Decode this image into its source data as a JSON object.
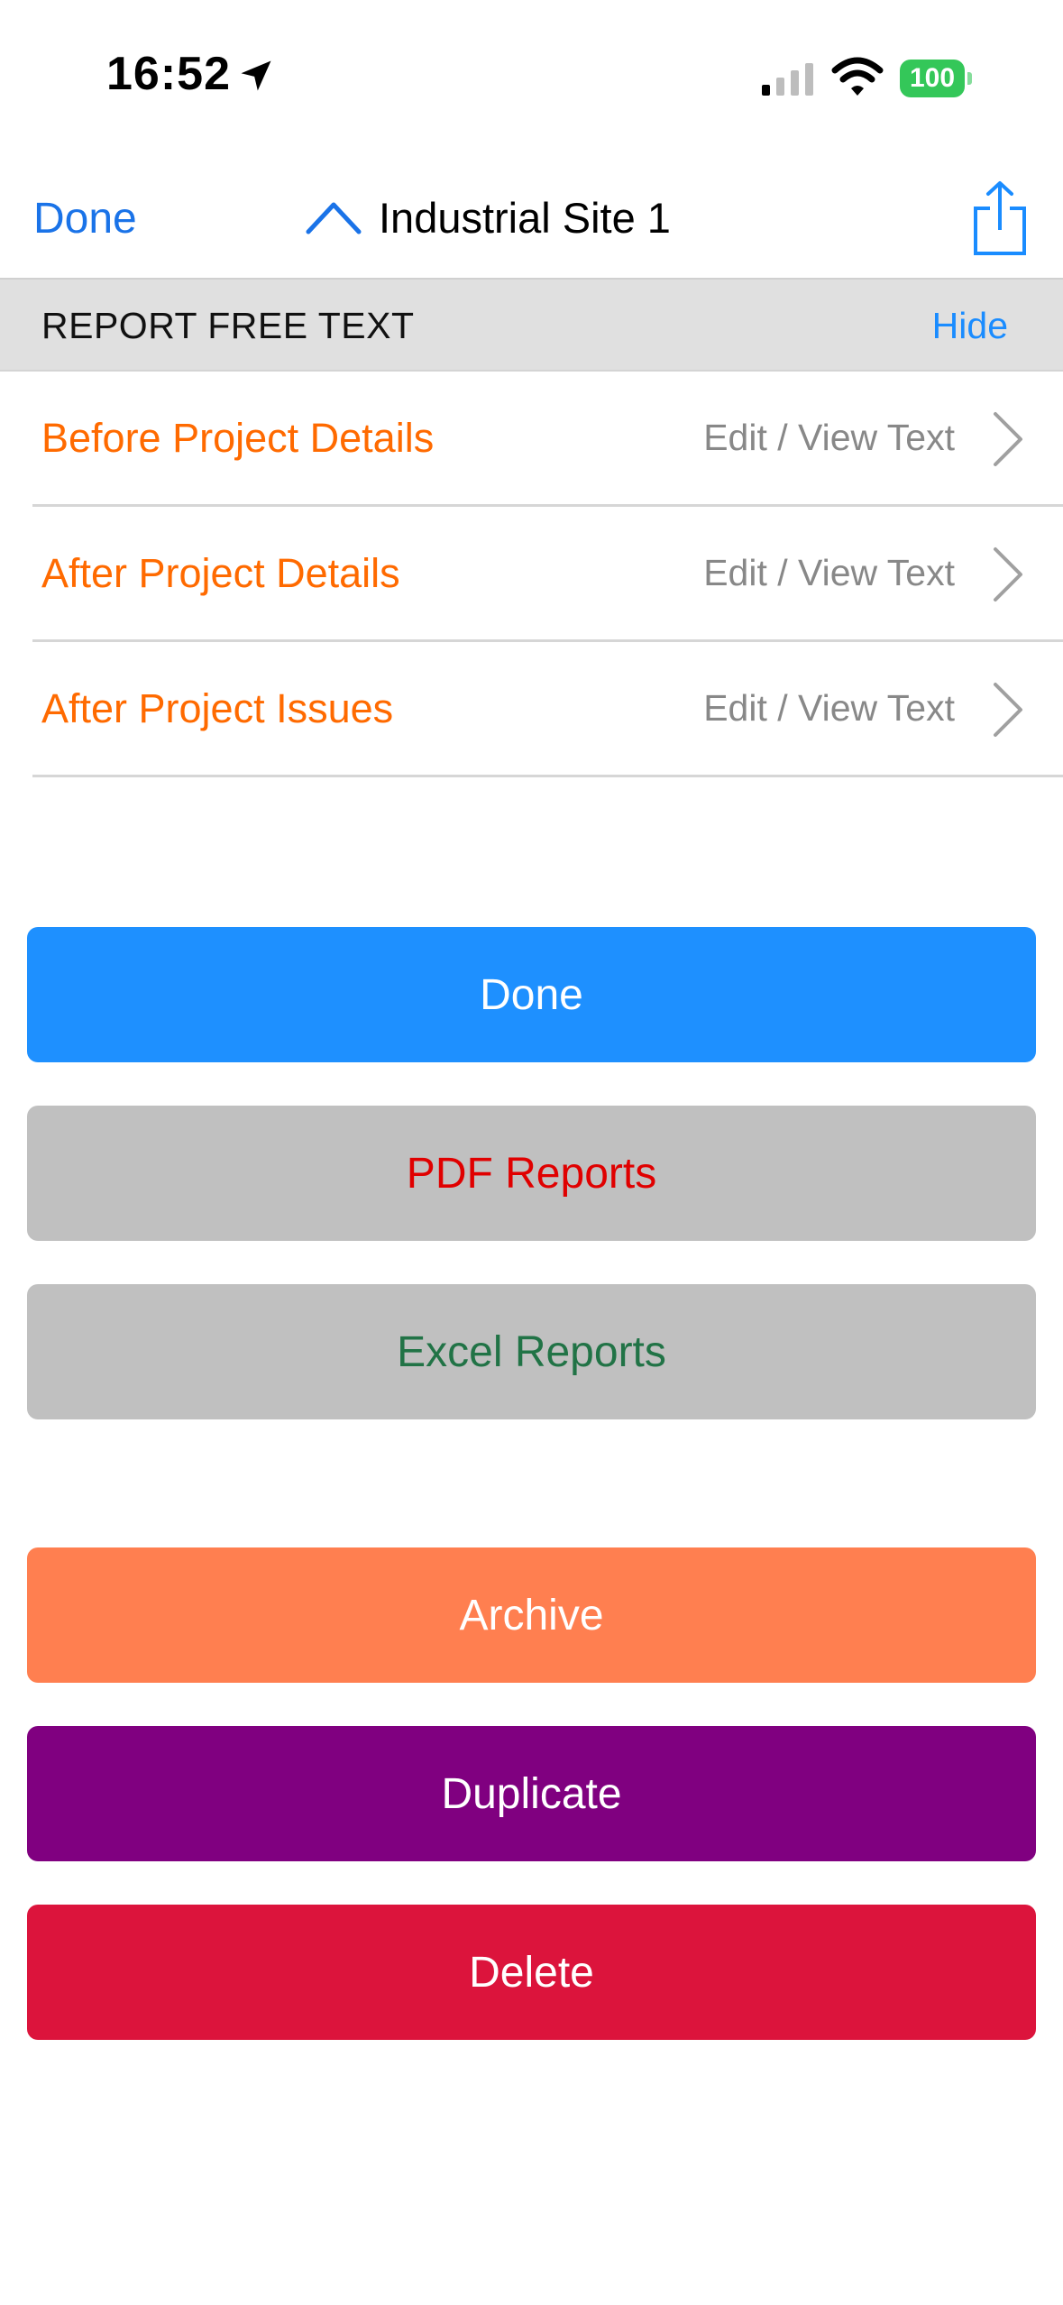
{
  "status_bar": {
    "time": "16:52",
    "battery": "100"
  },
  "nav": {
    "done_label": "Done",
    "title": "Industrial Site 1"
  },
  "section": {
    "title": "REPORT FREE TEXT",
    "hide_label": "Hide"
  },
  "rows": [
    {
      "label": "Before Project Details",
      "detail": "Edit / View Text"
    },
    {
      "label": "After Project Details",
      "detail": "Edit / View Text"
    },
    {
      "label": "After Project Issues",
      "detail": "Edit / View Text"
    }
  ],
  "buttons": {
    "done": "Done",
    "pdf_reports": "PDF Reports",
    "excel_reports": "Excel Reports",
    "archive": "Archive",
    "duplicate": "Duplicate",
    "delete": "Delete"
  },
  "colors": {
    "accent_blue": "#1a8cff",
    "row_label_orange": "#ff6a00",
    "done_button": "#1e90ff",
    "gray_button": "#c0c0c0",
    "pdf_text": "#e00000",
    "excel_text": "#217346",
    "archive_button": "#ff7f50",
    "duplicate_button": "#800080",
    "delete_button": "#dc143c"
  },
  "icons": [
    "location-arrow-icon",
    "cell-signal-icon",
    "wifi-icon",
    "battery-icon",
    "chevron-up-icon",
    "share-icon",
    "chevron-right-icon"
  ]
}
